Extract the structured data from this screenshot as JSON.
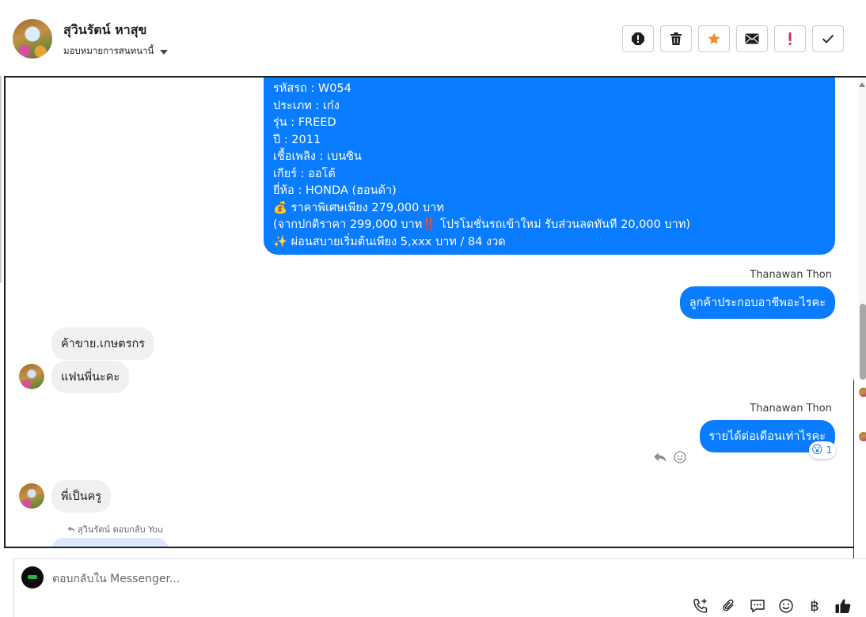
{
  "header": {
    "name": "สุวินรัตน์ หาสุข",
    "assign": "มอบหมายการสนทนานี้",
    "actions": [
      "report-icon",
      "trash-icon",
      "star-icon",
      "mail-icon",
      "exclamation-icon",
      "check-icon"
    ],
    "colors": {
      "star": "#f58a1f",
      "alert": "#e0245e"
    }
  },
  "chat": {
    "car_lines": [
      "รหัสรถ : W054",
      "ประเภท : เก๋ง",
      "รุ่น : FREED",
      "ปี : 2011",
      "เชื้อเพลิง : เบนซิน",
      "เกียร์ : ออโต้",
      "ยี่ห้อ : HONDA (ฮอนด้า)",
      "💰 ราคาพิเศษเพียง 279,000 บาท",
      "(จากปกติราคา 299,000 บาท‼️ โปรโมชั่นรถเข้าใหม่ รับส่วนลดทันที 20,000 บาท)",
      "✨ ผ่อนสบายเริ่มต้นเพียง 5,xxx บาท / 84 งวด"
    ],
    "sender_1": "Thanawan Thon",
    "out_msg_1": "ลูกค้าประกอบอาชีพอะไรคะ",
    "in_msg_1": "ค้าขาย.เกษตรกร",
    "in_msg_2": "แฟนพี่นะคะ",
    "sender_2": "Thanawan Thon",
    "out_msg_2": "รายได้ต่อเดือนเท่าไรคะ",
    "reaction_emoji": "😮",
    "reaction_count": "1",
    "in_msg_3": "พี่เป็นครู",
    "reply_note": "สุวินรัตน์ ตอบกลับ You",
    "brand_color": "#0a7cff"
  },
  "composer": {
    "placeholder": "ตอบกลับใน Messenger...",
    "icons": [
      "phone-add-icon",
      "paperclip-icon",
      "saved-reply-icon",
      "emoji-icon",
      "baht-icon",
      "like-icon"
    ],
    "baht_symbol": "฿"
  }
}
